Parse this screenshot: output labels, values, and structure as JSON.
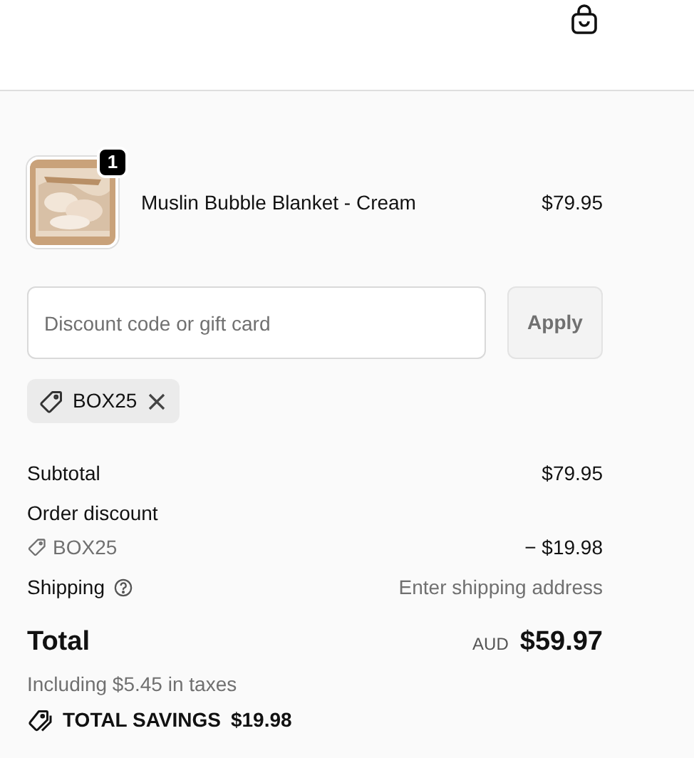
{
  "line_items": [
    {
      "name": "Muslin Bubble Blanket - Cream",
      "quantity": "1",
      "price": "$79.95"
    }
  ],
  "discount": {
    "placeholder": "Discount code or gift card",
    "button": "Apply",
    "button_disabled": true
  },
  "applied_codes": [
    {
      "code": "BOX25"
    }
  ],
  "summary": [
    {
      "kind": "line",
      "label": "Subtotal",
      "value": "$79.95"
    },
    {
      "kind": "heading",
      "label": "Order discount"
    },
    {
      "kind": "code",
      "label": "BOX25",
      "value": "− $19.98"
    },
    {
      "kind": "help",
      "label": "Shipping",
      "value": "Enter shipping address"
    }
  ],
  "total": {
    "label": "Total",
    "currency": "AUD",
    "amount": "$59.97",
    "taxes": "Including $5.45 in taxes"
  },
  "savings": {
    "label": "TOTAL SAVINGS",
    "amount": "$19.98"
  }
}
